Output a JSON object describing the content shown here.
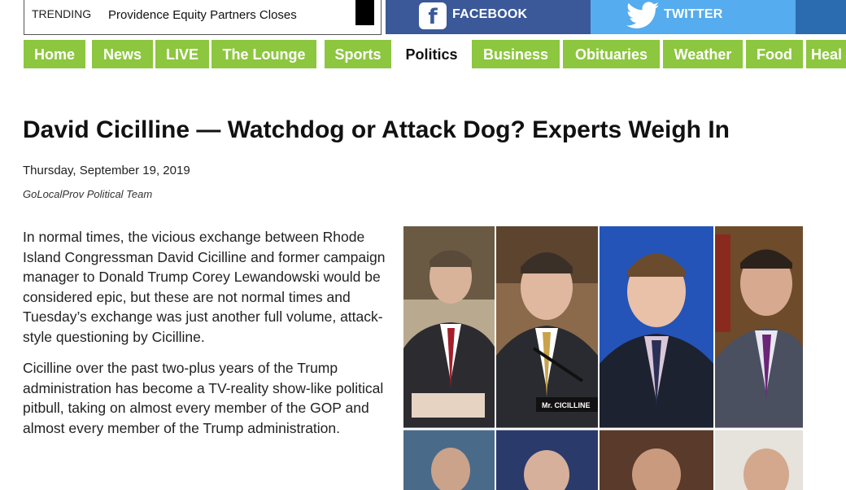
{
  "trending": {
    "label": "TRENDING",
    "text": "Providence Equity Partners Closes"
  },
  "social": {
    "facebook_label": "FACEBOOK",
    "twitter_label": "TWITTER"
  },
  "colors": {
    "nav_green": "#8dc63f",
    "facebook_blue": "#3b5998",
    "twitter_blue": "#55acee"
  },
  "nav": {
    "items": [
      {
        "label": "Home"
      },
      {
        "label": "News"
      },
      {
        "label": "LIVE"
      },
      {
        "label": "The Lounge"
      },
      {
        "label": "Sports"
      },
      {
        "label": "Politics"
      },
      {
        "label": "Business"
      },
      {
        "label": "Obituaries"
      },
      {
        "label": "Weather"
      },
      {
        "label": "Food"
      },
      {
        "label": "Heal"
      }
    ],
    "active": "Politics"
  },
  "article": {
    "headline": "David Cicilline — Watchdog or Attack Dog? Experts Weigh In",
    "date": "Thursday, September 19, 2019",
    "author": "GoLocalProv Political Team",
    "paragraphs": [
      "In normal times, the vicious exchange between Rhode Island Congressman David Cicilline and former campaign manager to Donald Trump Corey Lewandowski would be considered epic, but these are not normal times and Tuesday’s exchange was just another full volume, attack-style questioning by Cicilline.",
      "Cicilline over the past two-plus years of the Trump administration has become a TV-reality show-like political pitbull, taking on almost every member of the GOP and almost every member of the Trump administration."
    ],
    "image_caption_plate": "Mr. CICILLINE"
  }
}
